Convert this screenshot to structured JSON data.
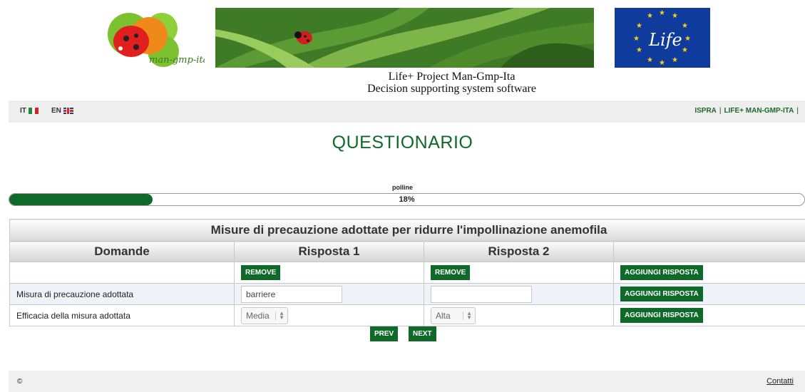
{
  "header": {
    "logo_left_text": "man-gmp-ita",
    "eu_logo_text": "Life",
    "subtitle_line1": "Life+ Project Man-Gmp-Ita",
    "subtitle_line2": "Decision supporting system software"
  },
  "lang": {
    "it": "IT",
    "en": "EN"
  },
  "nav": {
    "links": [
      "ISPRA",
      "LIFE+ MAN-GMP-ITA"
    ]
  },
  "page_title": "QUESTIONARIO",
  "progress": {
    "name": "polline",
    "label": "18%",
    "fraction": 0.18
  },
  "table": {
    "caption": "Misure di precauzione adottate per ridurre l'impollinazione anemofila",
    "headers": [
      "Domande",
      "Risposta 1",
      "Risposta 2",
      ""
    ],
    "remove_label": "REMOVE",
    "add_label": "AGGIUNGI RISPOSTA",
    "rows": [
      {
        "question": "Misura di precauzione adottata",
        "answer1": "barriere",
        "answer2": ""
      },
      {
        "question": "Efficacia della misura adottata",
        "answer1": "Media",
        "answer2": "Alta"
      }
    ]
  },
  "pager": {
    "prev": "PREV",
    "next": "NEXT"
  },
  "footer": {
    "copyright": "©",
    "contact": "Contatti"
  },
  "colors": {
    "primary_green": "#0f6a2a",
    "nav_green": "#1a6a2a",
    "eu_blue": "#0f3b9c"
  }
}
